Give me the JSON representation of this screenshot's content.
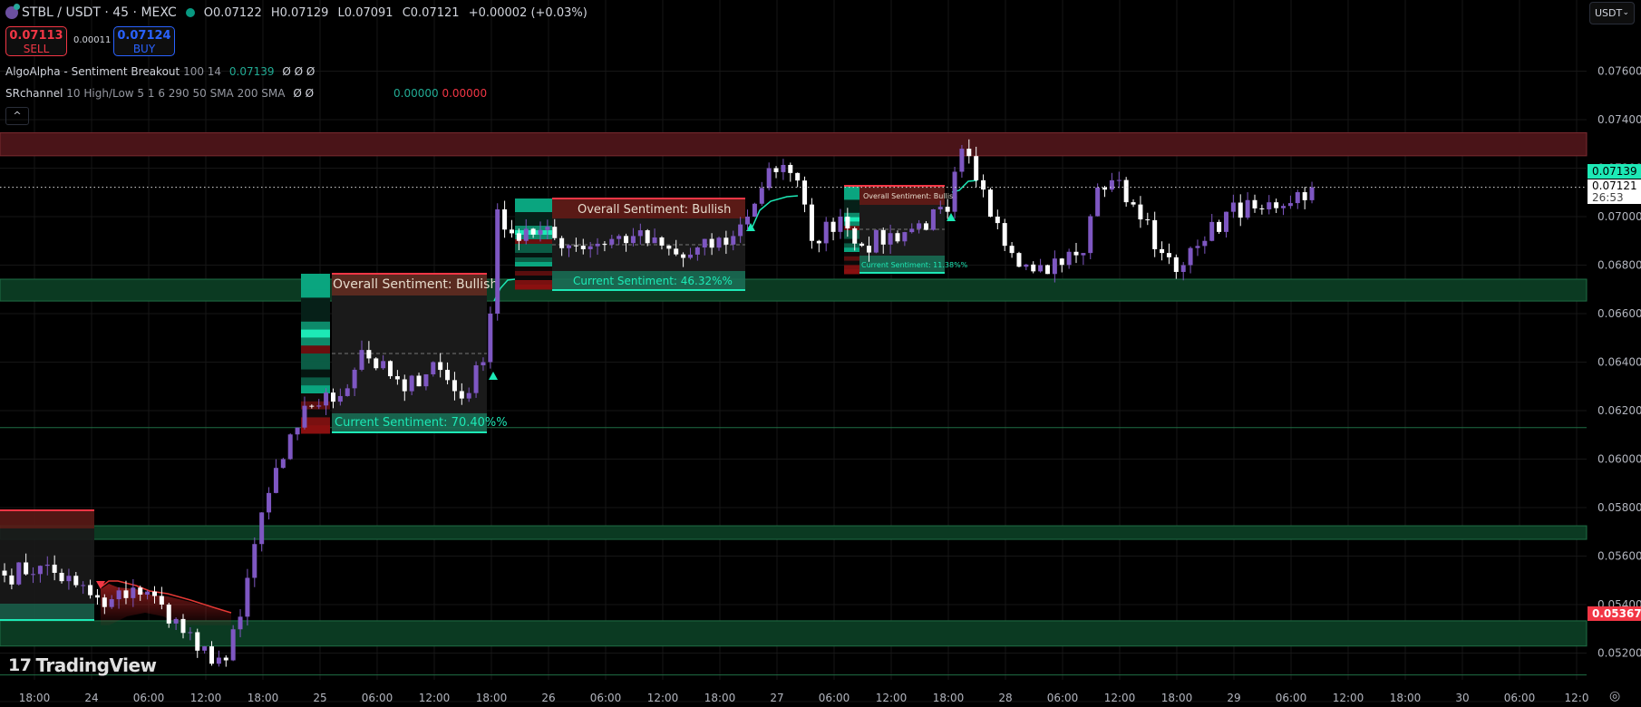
{
  "header": {
    "symbol": "STBL / USDT · 45 · MEXC",
    "open": "O0.07122",
    "high": "H0.07129",
    "low": "L0.07091",
    "close": "C0.07121",
    "change": "+0.00002 (+0.03%)"
  },
  "trade": {
    "sell_price": "0.07113",
    "sell_label": "SELL",
    "spread": "0.00011",
    "buy_price": "0.07124",
    "buy_label": "BUY"
  },
  "indicators": [
    {
      "name": "AlgoAlpha - Sentiment Breakout",
      "params": "100 14",
      "value": "0.07139",
      "extras": "Ø Ø Ø"
    },
    {
      "name": "SRchannel",
      "params": "10 High/Low 5 1 6 290 50 SMA 200 SMA",
      "extras": "Ø Ø",
      "value_up": "0.00000",
      "value_down": "0.00000"
    }
  ],
  "collapse_label": "^",
  "currency": "USDT",
  "price_axis": {
    "labels": [
      "0.07600",
      "0.07400",
      "0.07200",
      "0.07000",
      "0.06800",
      "0.06600",
      "0.06400",
      "0.06200",
      "0.06000",
      "0.05800",
      "0.05600",
      "0.05400",
      "0.05200"
    ],
    "indicator_tag": "0.07139",
    "last_price": "0.07121",
    "countdown": "26:53",
    "low_tag": "0.05367"
  },
  "time_axis": [
    "18:00",
    "24",
    "06:00",
    "12:00",
    "18:00",
    "25",
    "06:00",
    "12:00",
    "18:00",
    "26",
    "06:00",
    "12:00",
    "18:00",
    "27",
    "06:00",
    "12:00",
    "18:00",
    "28",
    "06:00",
    "12:00",
    "18:00",
    "29",
    "06:00",
    "12:00",
    "18:00",
    "30",
    "06:00",
    "12:0"
  ],
  "sentiment_boxes": [
    {
      "overall": "Overall Sentiment: Bullish",
      "current": "Current Sentiment: 70.40%%"
    },
    {
      "overall": "Overall Sentiment: Bullish",
      "current": "Current Sentiment: 46.32%%"
    },
    {
      "overall": "Overall Sentiment: Bullish",
      "current": "Current Sentiment: 11.38%%"
    }
  ],
  "chart_data": {
    "type": "candlestick",
    "interval": "45m",
    "price_path": [
      [
        0,
        0.0552
      ],
      [
        5,
        0.0556
      ],
      [
        10,
        0.0548
      ],
      [
        14,
        0.0539
      ],
      [
        18,
        0.0547
      ],
      [
        22,
        0.054
      ],
      [
        27,
        0.0521
      ],
      [
        31,
        0.0517
      ],
      [
        33,
        0.0535
      ],
      [
        36,
        0.0578
      ],
      [
        39,
        0.06
      ],
      [
        41,
        0.0613
      ],
      [
        42,
        0.0622
      ],
      [
        47,
        0.0626
      ],
      [
        50,
        0.0645
      ],
      [
        56,
        0.0628
      ],
      [
        60,
        0.064
      ],
      [
        64,
        0.0625
      ],
      [
        67,
        0.064
      ],
      [
        68,
        0.066
      ],
      [
        69,
        0.0703
      ],
      [
        72,
        0.069
      ],
      [
        73,
        0.0695
      ],
      [
        80,
        0.0688
      ],
      [
        88,
        0.0692
      ],
      [
        95,
        0.0683
      ],
      [
        102,
        0.0692
      ],
      [
        104,
        0.07
      ],
      [
        107,
        0.072
      ],
      [
        110,
        0.0718
      ],
      [
        112,
        0.0705
      ],
      [
        113,
        0.069
      ],
      [
        117,
        0.07
      ],
      [
        120,
        0.0688
      ],
      [
        127,
        0.0695
      ],
      [
        132,
        0.0702
      ],
      [
        134,
        0.0728
      ],
      [
        136,
        0.0715
      ],
      [
        138,
        0.07
      ],
      [
        141,
        0.0685
      ],
      [
        145,
        0.068
      ],
      [
        151,
        0.0685
      ],
      [
        153,
        0.0712
      ],
      [
        155,
        0.0715
      ],
      [
        158,
        0.0705
      ],
      [
        162,
        0.0685
      ],
      [
        165,
        0.068
      ],
      [
        168,
        0.069
      ],
      [
        171,
        0.0702
      ],
      [
        176,
        0.0703
      ],
      [
        183,
        0.07121
      ]
    ],
    "sr_zones": [
      {
        "type": "resistance",
        "top": 0.07346,
        "bottom": 0.07251
      },
      {
        "type": "support",
        "top": 0.06742,
        "bottom": 0.06652
      },
      {
        "type": "support",
        "top": 0.05725,
        "bottom": 0.05669
      },
      {
        "type": "support",
        "top": 0.05333,
        "bottom": 0.05229
      }
    ],
    "sr_lines": [
      0.0613,
      0.0511
    ],
    "last_price": 0.07121,
    "up_color": "#7e57c2",
    "down_color": "#ffffff",
    "ylim": [
      0.0505,
      0.0775
    ]
  }
}
